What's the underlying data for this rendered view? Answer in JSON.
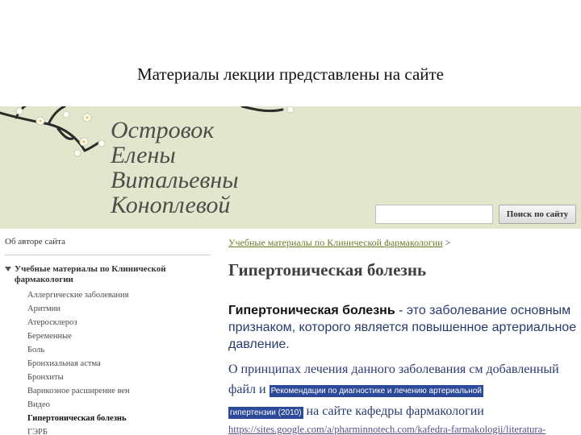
{
  "slide": {
    "title": "Материалы лекции представлены на сайте"
  },
  "header": {
    "site_name": [
      "Островок",
      "Елены",
      "Витальевны",
      "Коноплевой"
    ],
    "search_placeholder": "",
    "search_button": "Поиск по сайту"
  },
  "sidebar": {
    "about": "Об авторе сайта",
    "section_title": "Учебные материалы по Клинической фармакологии",
    "items": [
      "Аллергические заболевания",
      "Аритмии",
      "Атеросклероз",
      "Беременные",
      "Боль",
      "Бронхиальная астма",
      "Бронхиты",
      "Варикозное расширение вен",
      "Видео",
      "Гипертоническая болезнь",
      "ГЭРБ"
    ],
    "active_item": "Гипертоническая болезнь"
  },
  "main": {
    "breadcrumb_link": "Учебные материалы по Клинической фармакологии",
    "breadcrumb_sep": ">",
    "page_title": "Гипертоническая болезнь",
    "definition_term": "Гипертоническая болезнь",
    "definition_rest": " - это заболевание основным признаком, которого является повышенное артериальное давление.",
    "para_1": "О принципах лечения данного заболевания см добавленный файл и ",
    "attachment_part1": "Рекомендации по диагностике и лечению артериальной",
    "attachment_part2": "гипертензии (2010)",
    "para_2": " на сайте кафедры фармакологии",
    "url": "https://sites.google.com/a/pharminnotech.com/kafedra-farmakologii/literatura-"
  },
  "colors": {
    "header_bg": "#e1e6cd",
    "link": "#6e7a2a",
    "body_text": "#2a3b6e",
    "highlight": "#2d4a9a"
  }
}
